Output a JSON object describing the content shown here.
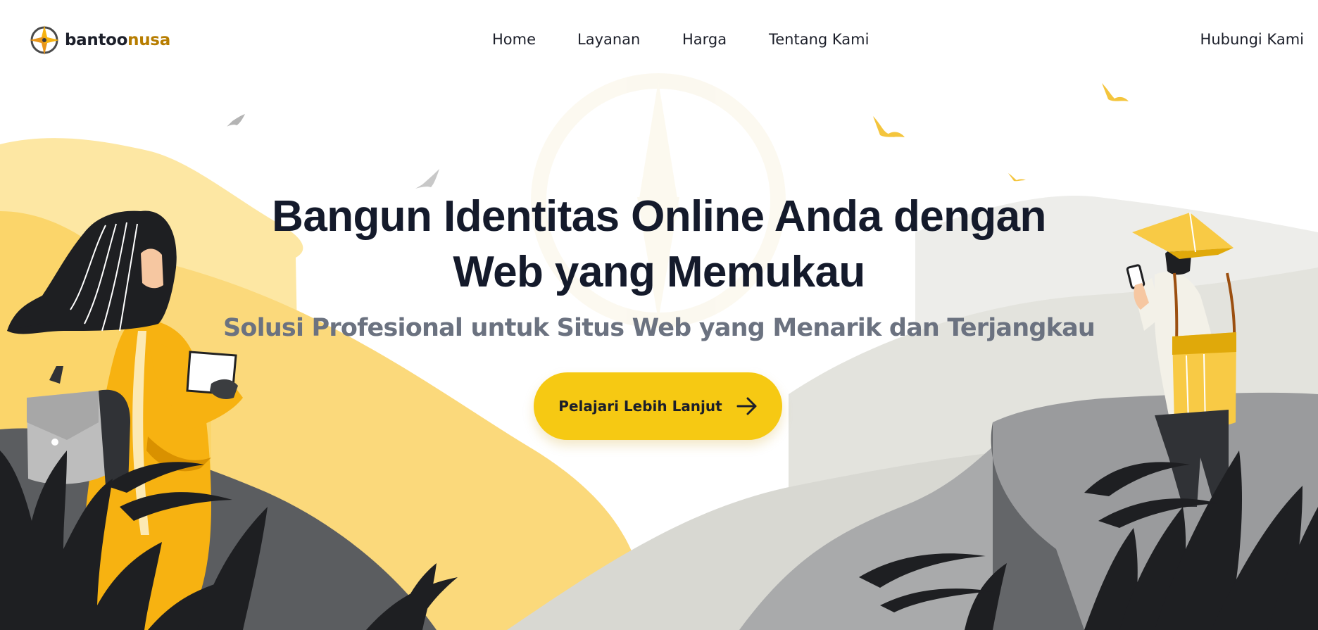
{
  "brand": {
    "name_part1": "bantoo",
    "name_part2": "nusa",
    "icon": "compass-logo-icon"
  },
  "nav": {
    "items": [
      {
        "label": "Home"
      },
      {
        "label": "Layanan"
      },
      {
        "label": "Harga"
      },
      {
        "label": "Tentang Kami"
      }
    ],
    "contact_label": "Hubungi Kami"
  },
  "hero": {
    "title_line1": "Bangun Identitas Online Anda dengan",
    "title_line2": "Web yang Memukau",
    "subtitle": "Solusi Profesional untuk Situs Web yang Menarik dan Terjangkau",
    "cta_label": "Pelajari Lebih Lanjut",
    "cta_icon": "arrow-right-icon"
  },
  "colors": {
    "accent": "#f6c913",
    "brand_secondary": "#b77d00",
    "heading": "#141a2b",
    "subtitle": "#6b7280",
    "dark_foliage": "#1e1f22"
  }
}
